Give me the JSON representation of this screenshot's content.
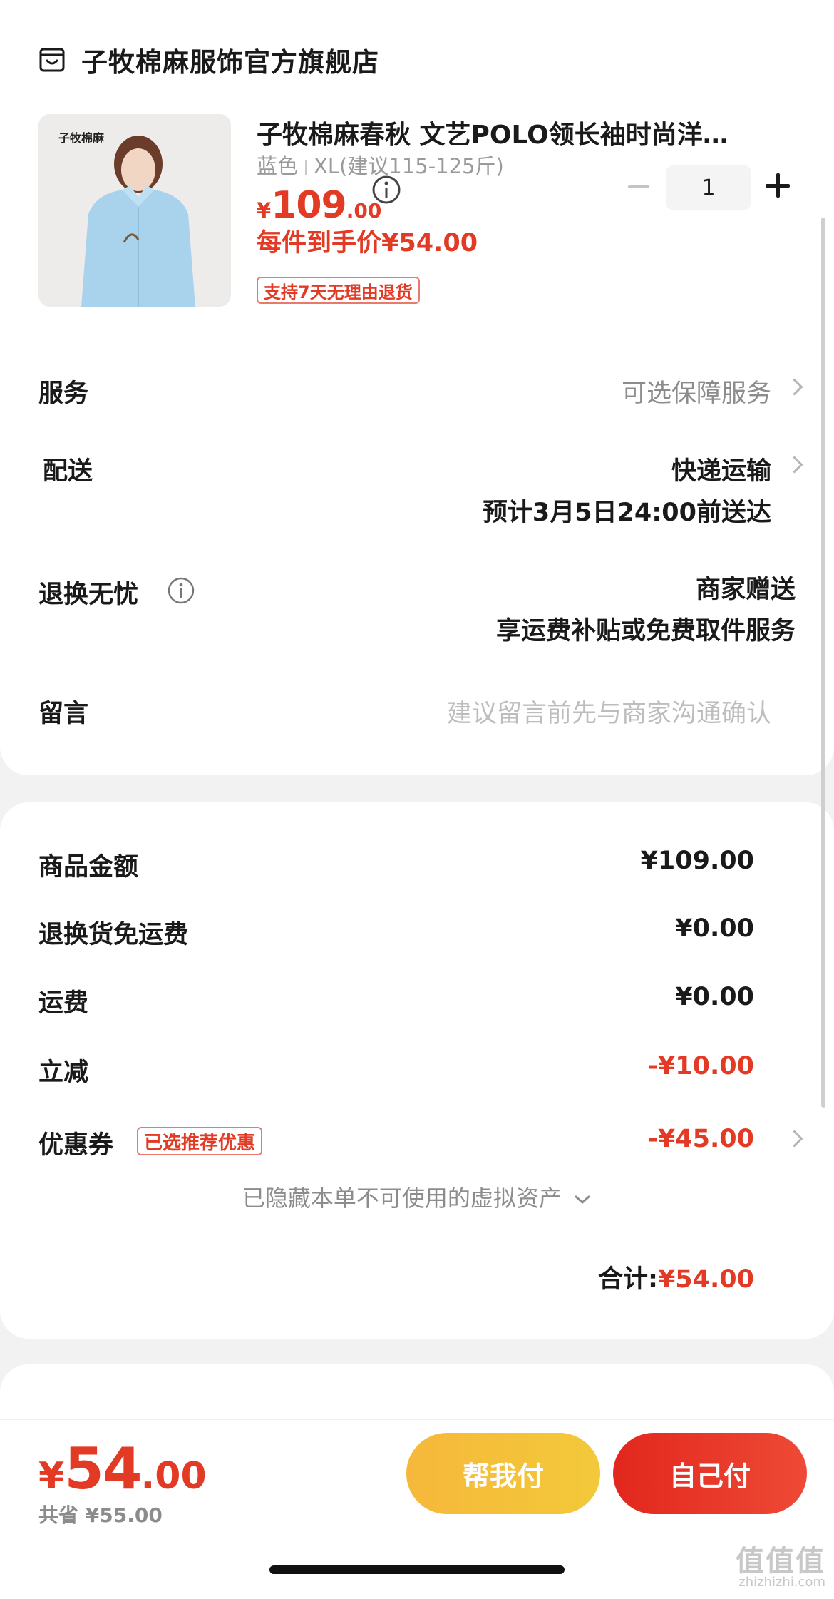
{
  "shop": {
    "name": "子牧棉麻服饰官方旗舰店",
    "icon": "store-icon"
  },
  "product": {
    "thumb_tag": "子牧棉麻",
    "title": "子牧棉麻春秋 文艺POLO领长袖时尚洋…",
    "color": "蓝色",
    "size": "XL(建议115-125斤)",
    "price_currency": "¥",
    "price_int": "109",
    "price_dec": ".00",
    "per_item_price": "每件到手价¥54.00",
    "return_badge": "支持7天无理由退货",
    "quantity": "1"
  },
  "rows": {
    "service_label": "服务",
    "service_value": "可选保障服务",
    "delivery_label": "配送",
    "delivery_value": "快递运输",
    "delivery_eta": "预计3月5日24:00前送达",
    "worry_free_label": "退换无忧",
    "worry_free_value": "商家赠送",
    "worry_free_desc": "享运费补贴或免费取件服务",
    "message_label": "留言",
    "message_placeholder": "建议留言前先与商家沟通确认"
  },
  "summary": {
    "goods_label": "商品金额",
    "goods_value": "¥109.00",
    "return_ship_label": "退换货免运费",
    "return_ship_value": "¥0.00",
    "shipping_label": "运费",
    "shipping_value": "¥0.00",
    "discount_label": "立减",
    "discount_value": "-¥10.00",
    "coupon_label": "优惠券",
    "coupon_badge": "已选推荐优惠",
    "coupon_value": "-¥45.00",
    "hidden_assets": "已隐藏本单不可使用的虚拟资产",
    "total_label": "合计:",
    "total_value": "¥54.00"
  },
  "bottom": {
    "price_currency": "¥",
    "price_int": "54",
    "price_dec": ".00",
    "saved": "共省 ¥55.00",
    "help_pay": "帮我付",
    "self_pay": "自己付"
  },
  "watermark": {
    "text": "值值值",
    "sub": "zhizhizhi.com"
  },
  "colors": {
    "accent_red": "#e23a24",
    "accent_yellow": "#f6b83b"
  }
}
